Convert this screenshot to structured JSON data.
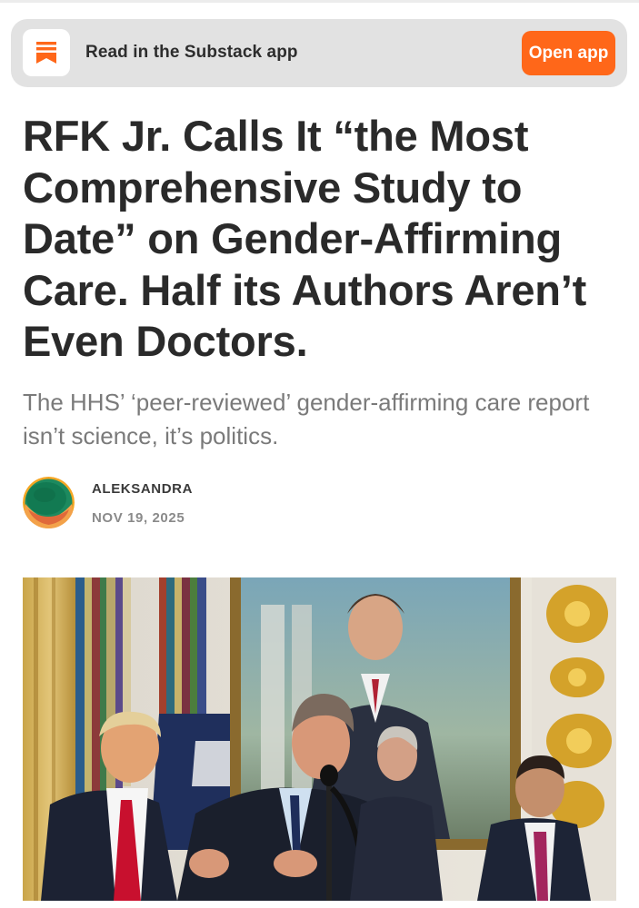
{
  "banner": {
    "icon": "substack-bookmark-icon",
    "text": "Read in the Substack app",
    "button_label": "Open app",
    "accent_color": "#ff6719"
  },
  "article": {
    "title": "RFK Jr. Calls It “the Most Comprehensive Study to Date” on Gender-Affirming Care. Half its Authors Aren’t Even Doctors.",
    "subtitle": "The HHS’ ‘peer-reviewed’ gender-affirming care report isn’t science, it’s politics.",
    "author": "ALEKSANDRA",
    "date": "NOV 19, 2025"
  },
  "hero_image": {
    "description_icon": "press-conference-photo"
  }
}
